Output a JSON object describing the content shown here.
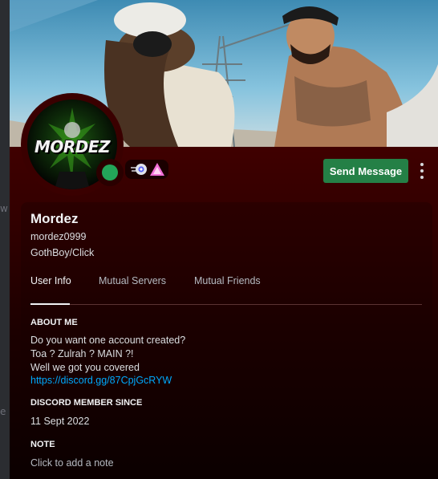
{
  "background": {
    "left_glyph_1": "w",
    "left_glyph_2": "e"
  },
  "profile": {
    "theme_color": "#5c0000",
    "avatar_text": "MORDEZ",
    "status_color": "#23a559",
    "badges": [
      "hypesquad-speed-icon",
      "triangle-badge-icon"
    ],
    "send_message_label": "Send Message",
    "display_name": "Mordez",
    "username": "mordez0999",
    "pronouns": "GothBoy/Click",
    "tabs": [
      {
        "label": "User Info",
        "active": true
      },
      {
        "label": "Mutual Servers",
        "active": false
      },
      {
        "label": "Mutual Friends",
        "active": false
      }
    ],
    "about_me": {
      "title": "ABOUT ME",
      "lines": [
        "Do you want one account created?",
        "Toa ? Zulrah ? MAIN ?!",
        "Well we got you covered"
      ],
      "link": "https://discord.gg/87CpjGcRYW"
    },
    "member_since": {
      "title": "DISCORD MEMBER SINCE",
      "date": "11 Sept 2022"
    },
    "note": {
      "title": "NOTE",
      "placeholder": "Click to add a note"
    }
  }
}
